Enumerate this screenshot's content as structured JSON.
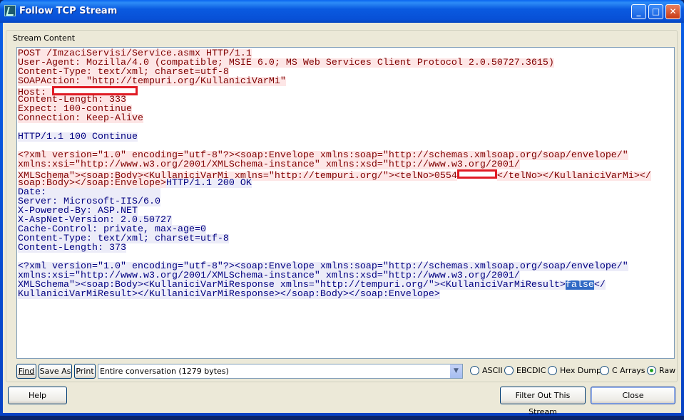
{
  "window": {
    "title": "Follow TCP Stream",
    "buttons": {
      "minimize": "_",
      "maximize": "□",
      "close": "✕"
    }
  },
  "group_label": "Stream Content",
  "colors": {
    "client_bg": "#fde6e6",
    "client_text": "#800000",
    "server_bg": "#ececf8",
    "server_text": "#000080",
    "redaction": "#e01b24",
    "selection": "#316ac5"
  },
  "stream_lines": [
    {
      "dir": "c",
      "segs": [
        {
          "t": "POST /ImzaciServisi/Service.asmx HTTP/1.1"
        }
      ]
    },
    {
      "dir": "c",
      "segs": [
        {
          "t": "User-Agent: Mozilla/4.0 (compatible; MSIE 6.0; MS Web Services Client Protocol 2.0.50727.3615)"
        }
      ]
    },
    {
      "dir": "c",
      "segs": [
        {
          "t": "Content-Type: text/xml; charset=utf-8"
        }
      ]
    },
    {
      "dir": "c",
      "segs": [
        {
          "t": "SOAPAction: \"http://tempuri.org/KullaniciVarMi\""
        }
      ]
    },
    {
      "dir": "c",
      "segs": [
        {
          "t": "Host: "
        },
        {
          "redacted": "lg"
        }
      ]
    },
    {
      "dir": "c",
      "segs": [
        {
          "t": "Content-Length: 333"
        }
      ]
    },
    {
      "dir": "c",
      "segs": [
        {
          "t": "Expect: 100-continue"
        }
      ]
    },
    {
      "dir": "c",
      "segs": [
        {
          "t": "Connection: Keep-Alive"
        }
      ]
    },
    {
      "dir": "",
      "segs": [
        {
          "t": ""
        }
      ]
    },
    {
      "dir": "s",
      "segs": [
        {
          "t": "HTTP/1.1 100 Continue"
        }
      ]
    },
    {
      "dir": "",
      "segs": [
        {
          "t": ""
        }
      ]
    },
    {
      "dir": "c",
      "segs": [
        {
          "t": "<?xml version=\"1.0\" encoding=\"utf-8\"?><soap:Envelope xmlns:soap=\"http://schemas.xmlsoap.org/soap/envelope/\""
        }
      ]
    },
    {
      "dir": "c",
      "segs": [
        {
          "t": "xmlns:xsi=\"http://www.w3.org/2001/XMLSchema-instance\" xmlns:xsd=\"http://www.w3.org/2001/"
        }
      ]
    },
    {
      "dir": "c",
      "segs": [
        {
          "t": "XMLSchema\"><soap:Body><KullaniciVarMi xmlns=\"http://tempuri.org/\"><telNo>0554"
        },
        {
          "redacted": "sm"
        },
        {
          "t": "</telNo></KullaniciVarMi></"
        }
      ]
    },
    {
      "dir": "c",
      "segs": [
        {
          "t": "soap:Body></soap:Envelope>"
        },
        {
          "t": "HTTP/1.1 200 OK",
          "dir": "s"
        }
      ]
    },
    {
      "dir": "s",
      "segs": [
        {
          "t": "Date:                    "
        }
      ]
    },
    {
      "dir": "s",
      "segs": [
        {
          "t": "Server: Microsoft-IIS/6.0"
        }
      ]
    },
    {
      "dir": "s",
      "segs": [
        {
          "t": "X-Powered-By: ASP.NET"
        }
      ]
    },
    {
      "dir": "s",
      "segs": [
        {
          "t": "X-AspNet-Version: 2.0.50727"
        }
      ]
    },
    {
      "dir": "s",
      "segs": [
        {
          "t": "Cache-Control: private, max-age=0"
        }
      ]
    },
    {
      "dir": "s",
      "segs": [
        {
          "t": "Content-Type: text/xml; charset=utf-8"
        }
      ]
    },
    {
      "dir": "s",
      "segs": [
        {
          "t": "Content-Length: 373"
        }
      ]
    },
    {
      "dir": "",
      "segs": [
        {
          "t": ""
        }
      ]
    },
    {
      "dir": "s",
      "segs": [
        {
          "t": "<?xml version=\"1.0\" encoding=\"utf-8\"?><soap:Envelope xmlns:soap=\"http://schemas.xmlsoap.org/soap/envelope/\""
        }
      ]
    },
    {
      "dir": "s",
      "segs": [
        {
          "t": "xmlns:xsi=\"http://www.w3.org/2001/XMLSchema-instance\" xmlns:xsd=\"http://www.w3.org/2001/"
        }
      ]
    },
    {
      "dir": "s",
      "segs": [
        {
          "t": "XMLSchema\"><soap:Body><KullaniciVarMiResponse xmlns=\"http://tempuri.org/\"><KullaniciVarMiResult>"
        },
        {
          "t": "false",
          "selected": true
        },
        {
          "t": "</"
        }
      ]
    },
    {
      "dir": "s",
      "segs": [
        {
          "t": "KullaniciVarMiResult></KullaniciVarMiResponse></soap:Body></soap:Envelope>"
        }
      ]
    }
  ],
  "toolbar": {
    "find": "Find",
    "save_as": "Save As",
    "print": "Print",
    "conversation": "Entire conversation (1279 bytes)",
    "formats": [
      {
        "label": "ASCII",
        "selected": false
      },
      {
        "label": "EBCDIC",
        "selected": false
      },
      {
        "label": "Hex Dump",
        "selected": false
      },
      {
        "label": "C Arrays",
        "selected": false
      },
      {
        "label": "Raw",
        "selected": true
      }
    ]
  },
  "footer": {
    "help": "Help",
    "filter": "Filter Out This Stream",
    "close": "Close"
  }
}
